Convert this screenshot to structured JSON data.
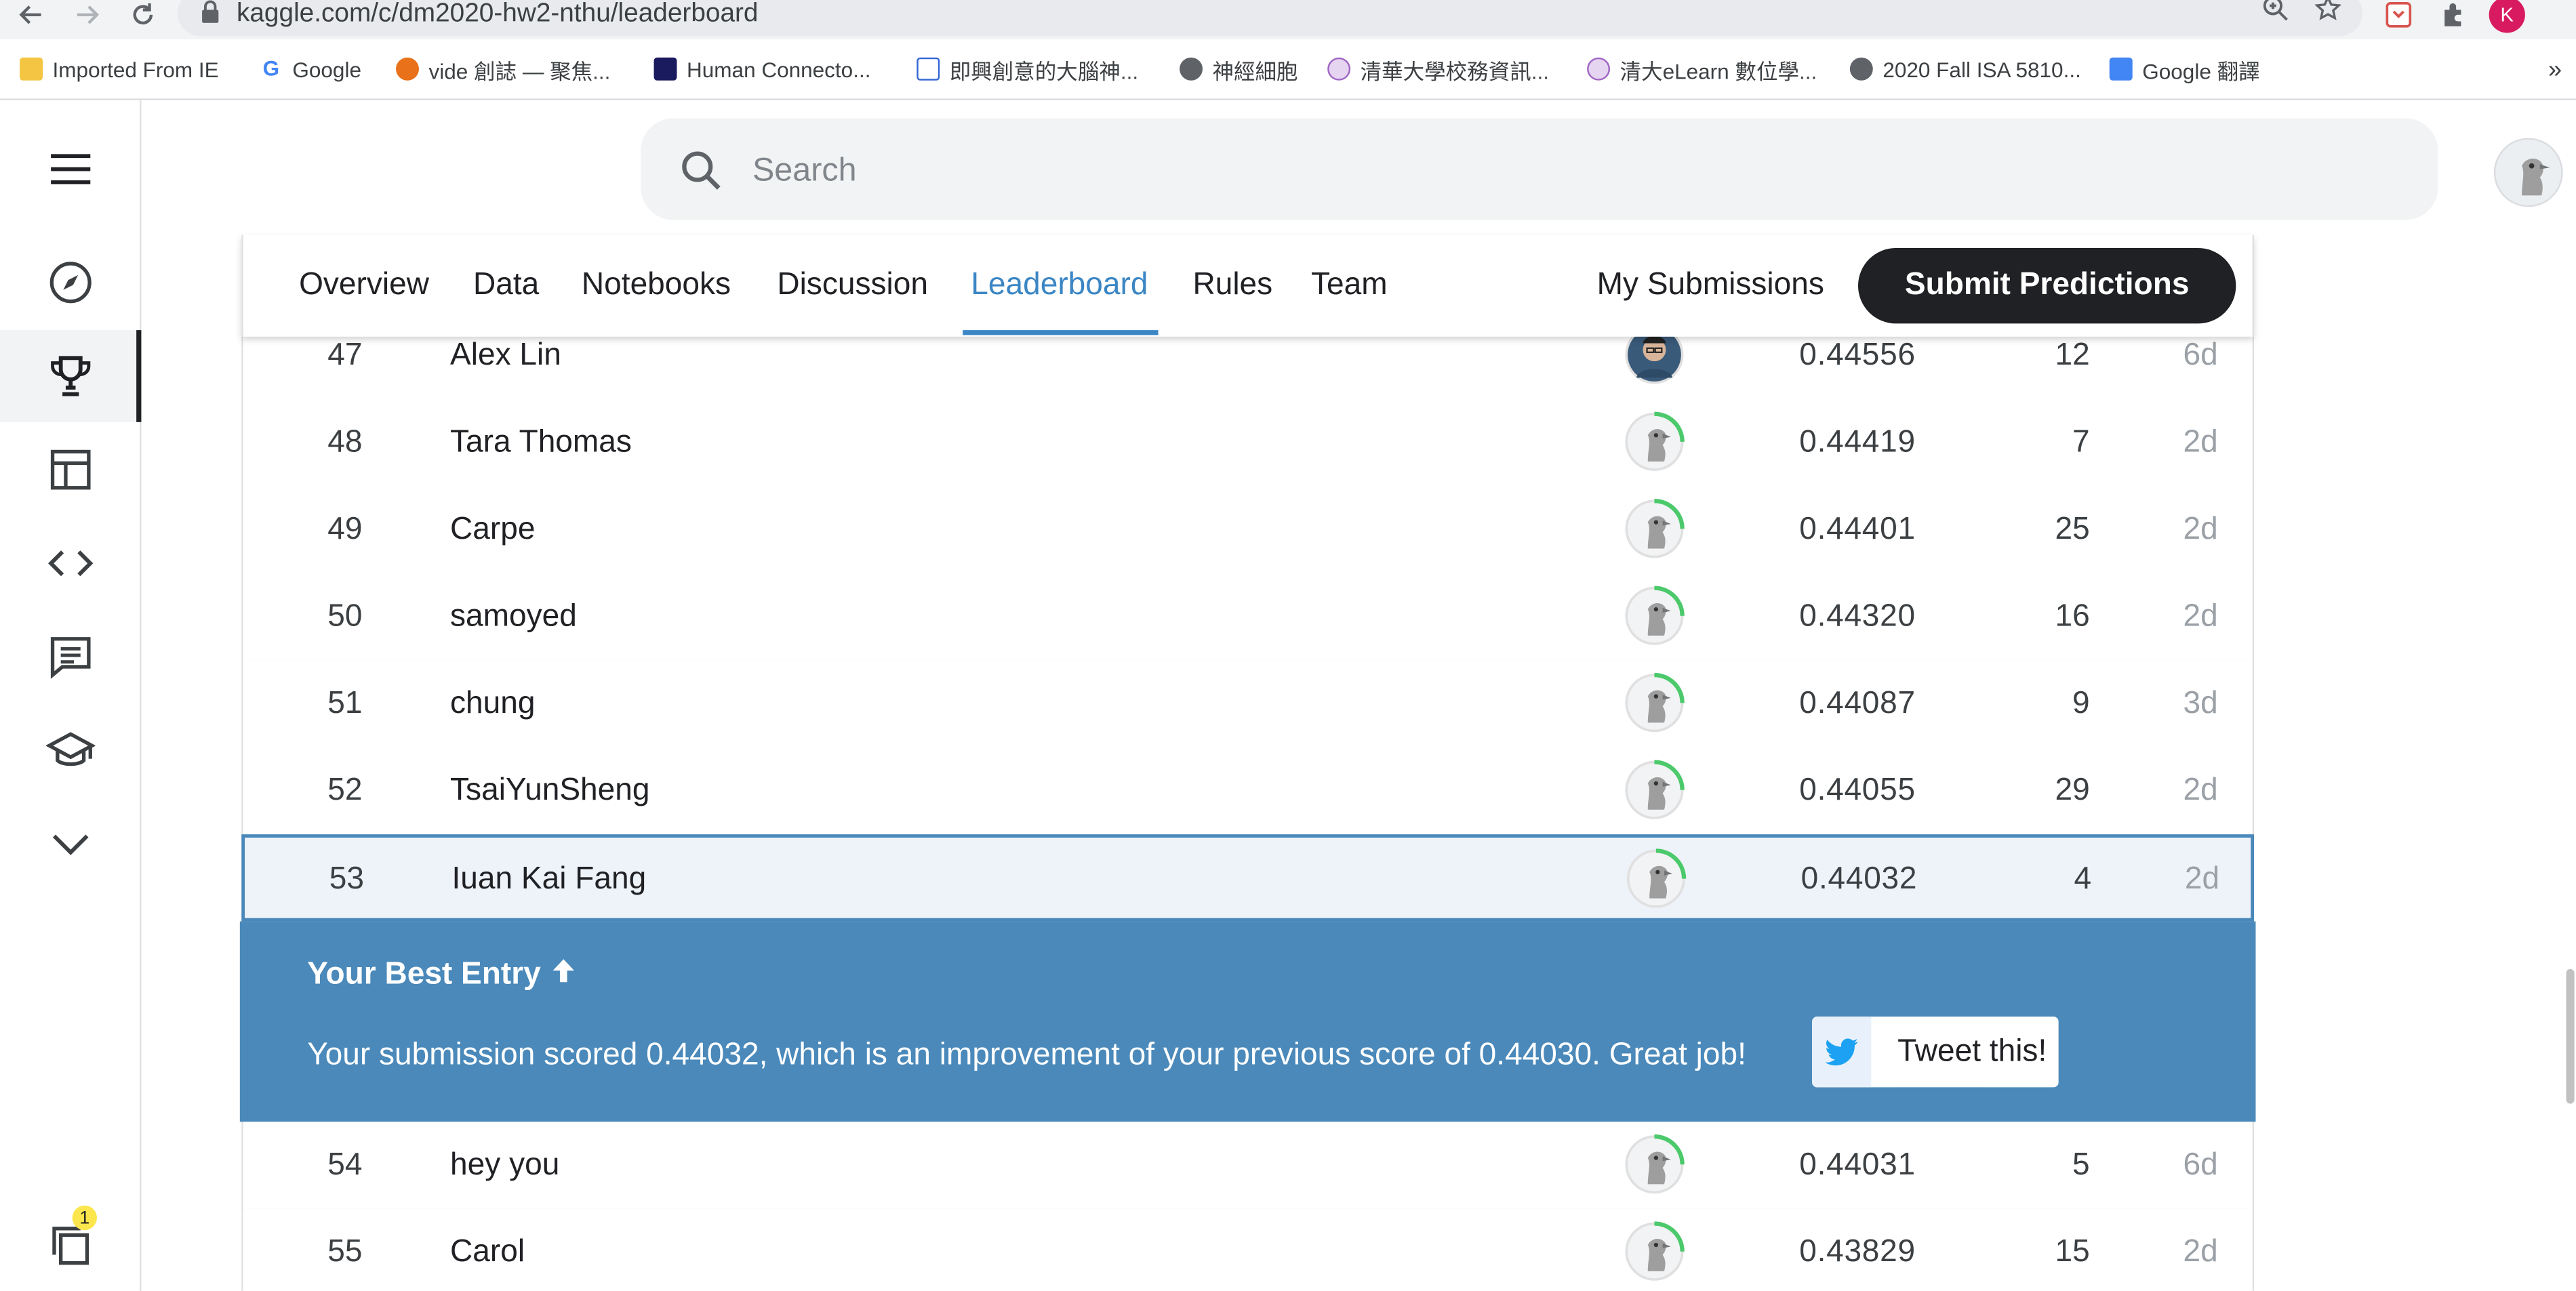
{
  "browser": {
    "url": "kaggle.com/c/dm2020-hw2-nthu/leaderboard",
    "profile_initial": "K",
    "overflow_chevron": "»"
  },
  "bookmarks": [
    {
      "label": "Imported From IE",
      "icon": "folder-icon",
      "color": "#f4c542"
    },
    {
      "label": "Google",
      "icon": "google-icon",
      "color": "#4285f4"
    },
    {
      "label": "vide 創誌 — 聚焦...",
      "icon": "vide-icon",
      "color": "#e8711a"
    },
    {
      "label": "Human Connecto...",
      "icon": "grid-icon",
      "color": "#1a1a5e"
    },
    {
      "label": "即興創意的大腦神...",
      "icon": "doc-icon",
      "color": "#3367d6"
    },
    {
      "label": "神經細胞",
      "icon": "globe-icon",
      "color": "#5f6368"
    },
    {
      "label": "清華大學校務資訊...",
      "icon": "seal-icon",
      "color": "#a066c4"
    },
    {
      "label": "清大eLearn 數位學...",
      "icon": "seal-icon",
      "color": "#a066c4"
    },
    {
      "label": "2020 Fall ISA 5810...",
      "icon": "globe-icon",
      "color": "#5f6368"
    },
    {
      "label": "Google 翻譯",
      "icon": "translate-icon",
      "color": "#4285f4"
    }
  ],
  "search": {
    "placeholder": "Search"
  },
  "tabs": [
    {
      "label": "Overview"
    },
    {
      "label": "Data"
    },
    {
      "label": "Notebooks"
    },
    {
      "label": "Discussion"
    },
    {
      "label": "Leaderboard",
      "active": true
    },
    {
      "label": "Rules"
    },
    {
      "label": "Team"
    }
  ],
  "actions": {
    "my_submissions": "My Submissions",
    "submit_predictions": "Submit Predictions"
  },
  "leaderboard_rows": [
    {
      "rank": "47",
      "team": "Alex Lin",
      "score": "0.44556",
      "entries": "12",
      "last": "6d",
      "avatar": "photo"
    },
    {
      "rank": "48",
      "team": "Tara Thomas",
      "score": "0.44419",
      "entries": "7",
      "last": "2d",
      "avatar": "default"
    },
    {
      "rank": "49",
      "team": "Carpe",
      "score": "0.44401",
      "entries": "25",
      "last": "2d",
      "avatar": "default"
    },
    {
      "rank": "50",
      "team": "samoyed",
      "score": "0.44320",
      "entries": "16",
      "last": "2d",
      "avatar": "default"
    },
    {
      "rank": "51",
      "team": "chung",
      "score": "0.44087",
      "entries": "9",
      "last": "3d",
      "avatar": "default"
    },
    {
      "rank": "52",
      "team": "TsaiYunSheng",
      "score": "0.44055",
      "entries": "29",
      "last": "2d",
      "avatar": "default"
    },
    {
      "rank": "53",
      "team": "Iuan Kai Fang",
      "score": "0.44032",
      "entries": "4",
      "last": "2d",
      "avatar": "default",
      "highlight": true
    },
    {
      "rank": "54",
      "team": "hey you",
      "score": "0.44031",
      "entries": "5",
      "last": "6d",
      "avatar": "default"
    },
    {
      "rank": "55",
      "team": "Carol",
      "score": "0.43829",
      "entries": "15",
      "last": "2d",
      "avatar": "default"
    }
  ],
  "best_entry": {
    "title": "Your Best Entry",
    "message": "Your submission scored 0.44032, which is an improvement of your previous score of 0.44030. Great job!",
    "tweet_label": "Tweet this!"
  },
  "side_nav": {
    "notification_count": "1",
    "items": [
      "menu-icon",
      "compass-icon",
      "trophy-icon",
      "table-icon",
      "code-icon",
      "discussion-icon",
      "courses-icon",
      "chevron-down-icon"
    ]
  },
  "colors": {
    "accent": "#3b86c4",
    "banner": "#4a89ba",
    "highlight_row": "#eef3fa",
    "button_dark": "#202124",
    "progress_green": "#20beff"
  }
}
